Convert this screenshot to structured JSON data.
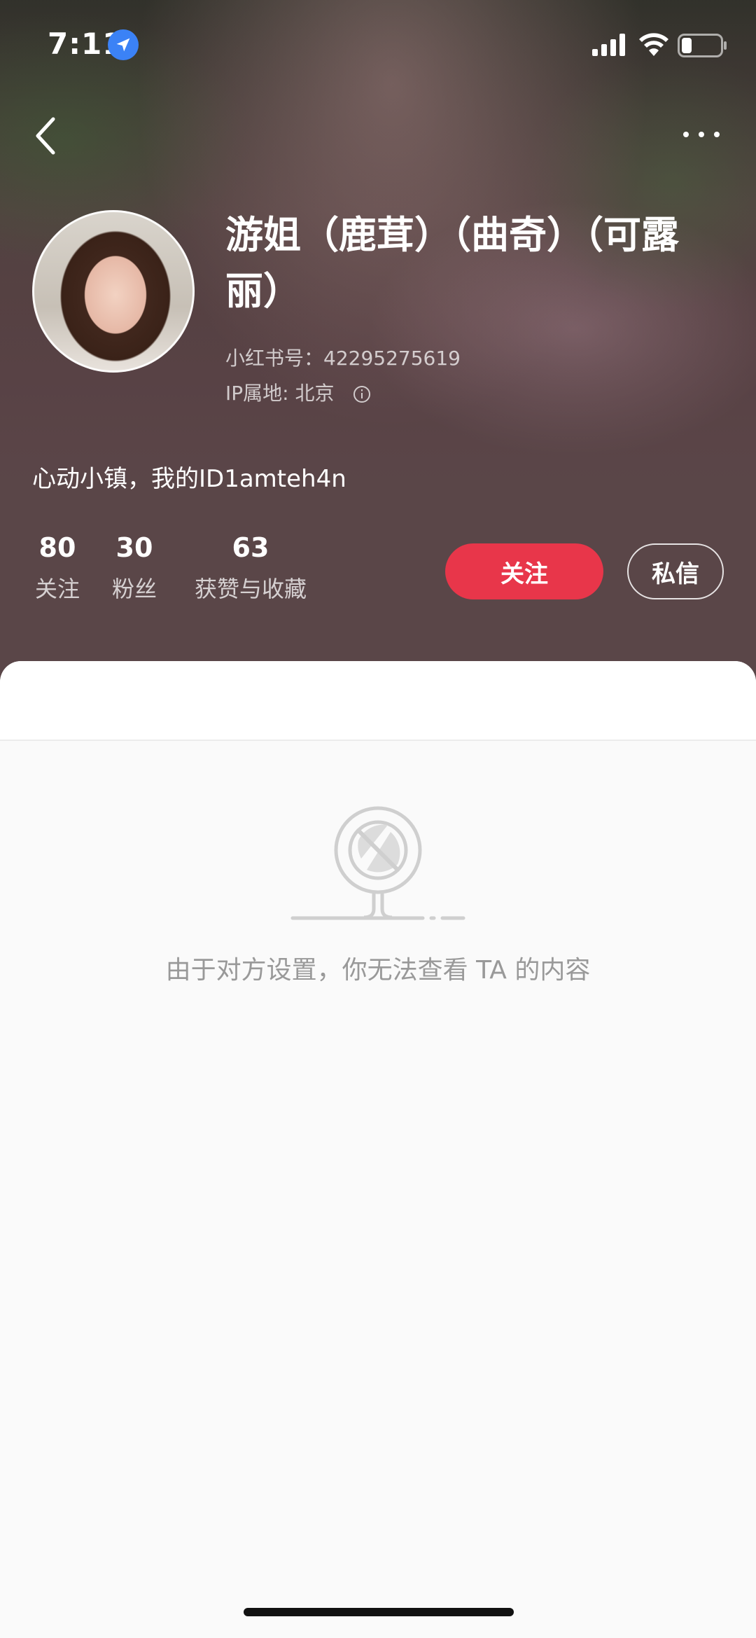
{
  "status_bar": {
    "time": "7:11"
  },
  "profile": {
    "name": "游姐（鹿茸）（曲奇）（可露丽）",
    "redbook_id": "小红书号：42295275619",
    "ip_location": "IP属地: 北京",
    "bio": "心动小镇，我的ID1amteh4n"
  },
  "stats": [
    {
      "value": "80",
      "label": "关注"
    },
    {
      "value": "30",
      "label": "粉丝"
    },
    {
      "value": "63",
      "label": "获赞与收藏"
    }
  ],
  "actions": {
    "follow_label": "关注",
    "message_label": "私信"
  },
  "content": {
    "empty_message": "由于对方设置，你无法查看 TA 的内容"
  },
  "colors": {
    "accent": "#e8364a",
    "hero_bg": "#5a4649",
    "empty_text": "#999999"
  }
}
